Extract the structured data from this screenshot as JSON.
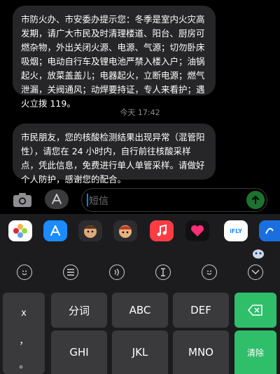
{
  "messages": [
    {
      "text": "市防火办、市安委办提示您：冬季是室内火灾高发期，请广大市民及时清理楼道、阳台、厨房可燃杂物，外出关闭火源、电源、气源；切勿卧床吸烟；电动自行车及锂电池严禁入楼入户；油锅起火，放菜盖盖儿；电器起火，立断电源；燃气泄漏，关阀通风；动焊要持证，专人来看护；遇火立拨 119。"
    },
    {
      "text": "市民朋友，您的核酸检测结果出现异常（混管阳性），请您在 24 小时内，自行前往核酸采样点，凭此信息，免费进行单人单管采样。请做好个人防护，感谢您的配合。"
    }
  ],
  "timestamp": "今天 17:42",
  "input": {
    "placeholder": "短信"
  },
  "apps": [
    "photos-app",
    "app-store-app",
    "memoji-app",
    "memoji-2-app",
    "music-app",
    "digital-touch-app",
    "ifly-app",
    "extra-app"
  ],
  "ifly_label": "iFLY",
  "keyboard": {
    "side_keys": [
      "x",
      "，",
      "。"
    ],
    "row1": [
      "分词",
      "ABC",
      "DEF"
    ],
    "row2": [
      "GHI",
      "JKL",
      "MNO"
    ],
    "clear_label": "清除"
  },
  "colors": {
    "bubble": "#262628",
    "accent": "#0a84ff",
    "green": "#2fbf6a"
  }
}
